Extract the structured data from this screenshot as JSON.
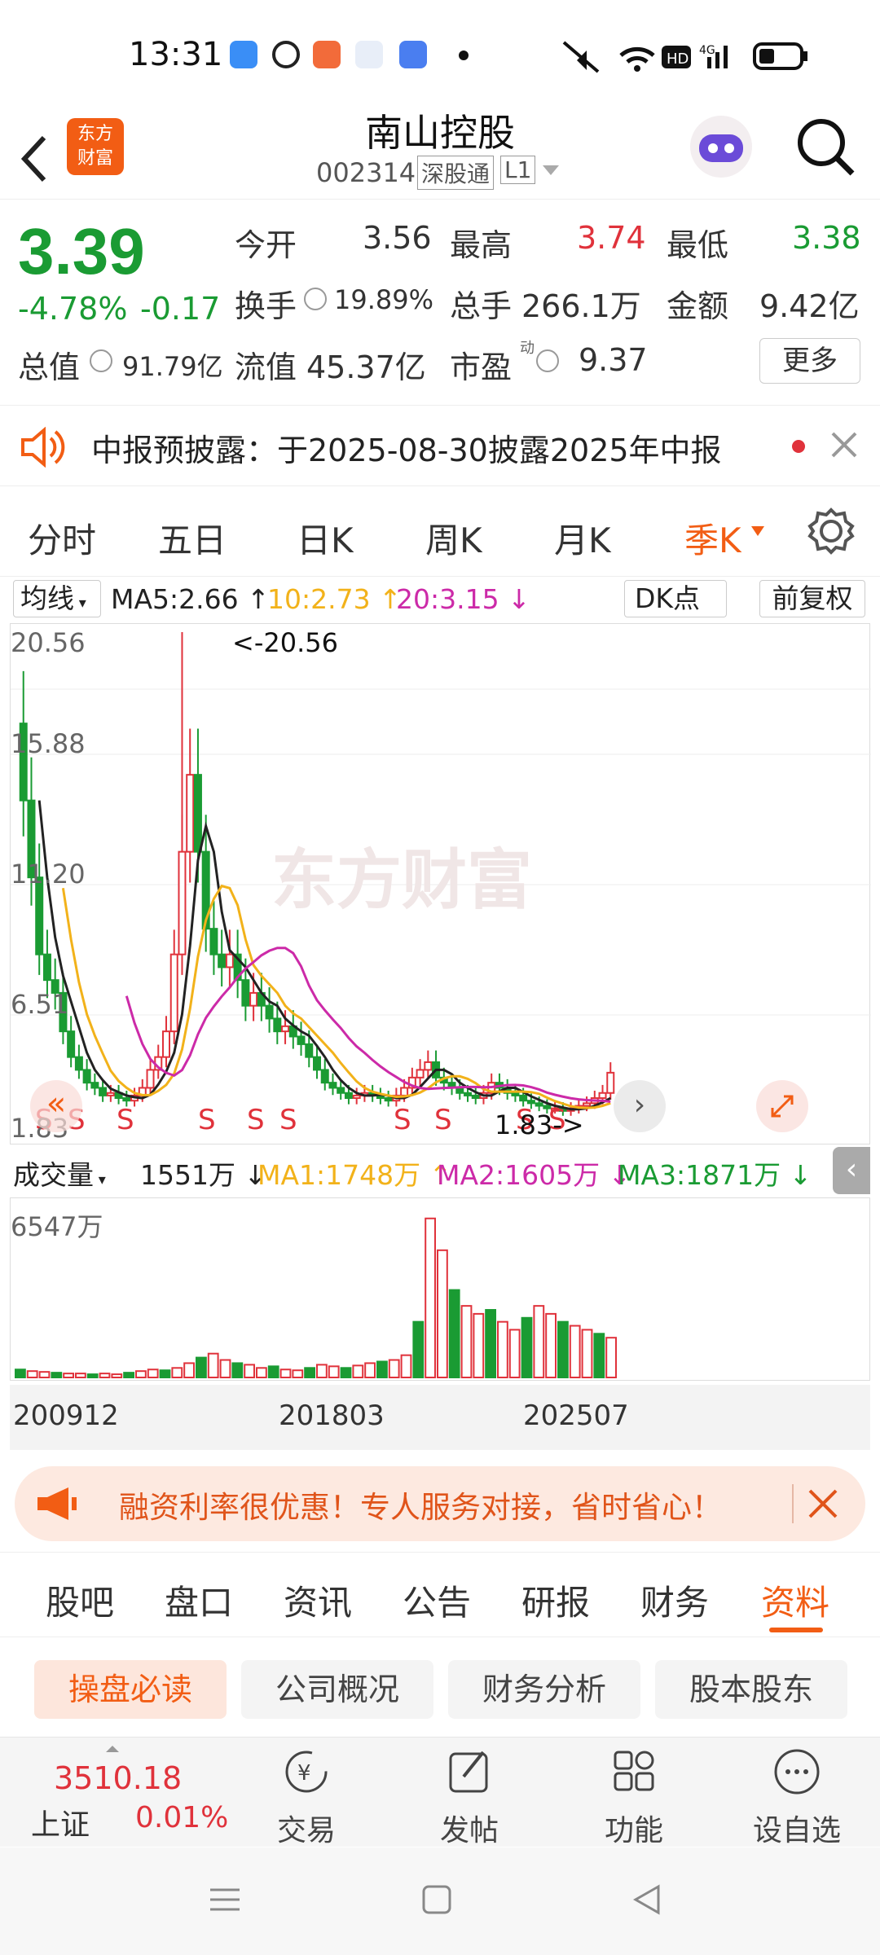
{
  "status": {
    "time": "13:31",
    "right_badge": "4G"
  },
  "header": {
    "title": "南山控股",
    "code": "002314",
    "tag1": "深股通",
    "tag2": "L1",
    "logo_top": "东方",
    "logo_bottom": "财富"
  },
  "quote": {
    "price": "3.39",
    "pct": "-4.78%",
    "chg": "-0.17",
    "open_label": "今开",
    "open": "3.56",
    "high_label": "最高",
    "high": "3.74",
    "low_label": "最低",
    "low": "3.38",
    "turnover_label": "换手",
    "turnover": "19.89%",
    "vol_label": "总手",
    "vol": "266.1万",
    "amount_label": "金额",
    "amount": "9.42亿",
    "mcap_label": "总值",
    "mcap": "91.79亿",
    "float_label": "流值",
    "float": "45.37亿",
    "pe_label": "市盈",
    "pe_sup": "动",
    "pe": "9.37",
    "more": "更多"
  },
  "notice": {
    "text": "中报预披露：于2025-08-30披露2025年中报"
  },
  "periods": [
    "分时",
    "五日",
    "日K",
    "周K",
    "月K"
  ],
  "period_active": "季K",
  "ma_legend": {
    "type": "均线",
    "ma5": "MA5:2.66",
    "ma10": "10:2.73",
    "ma20": "20:3.15",
    "dk": "DK点",
    "fq": "前复权"
  },
  "chart": {
    "y_labels": [
      "20.56",
      "15.88",
      "11.20",
      "6.51",
      "1.83"
    ],
    "max_label": "<-20.56",
    "min_label": "1.83->",
    "s_marker": "S",
    "watermark": "东方财富"
  },
  "vol_legend": {
    "label": "成交量",
    "cur": "1551万",
    "ma1": "MA1:1748万",
    "ma2": "MA2:1605万",
    "ma3": "MA3:1871万",
    "ymax": "6547万"
  },
  "dates": [
    "200912",
    "201803",
    "202507"
  ],
  "promo": {
    "text": "融资利率很优惠！专人服务对接，省时省心！"
  },
  "bottom_tabs": [
    "股吧",
    "盘口",
    "资讯",
    "公告",
    "研报",
    "财务",
    "资料"
  ],
  "sub_tabs": [
    "操盘必读",
    "公司概况",
    "财务分析",
    "股本股东"
  ],
  "index": {
    "value": "3510.18",
    "name": "上证",
    "pct": "0.01%"
  },
  "tools": [
    {
      "label": "交易",
      "icon": "trade-icon"
    },
    {
      "label": "发帖",
      "icon": "post-icon"
    },
    {
      "label": "功能",
      "icon": "apps-icon"
    },
    {
      "label": "设自选",
      "icon": "more-icon"
    }
  ],
  "colors": {
    "up": "#e0323b",
    "down": "#1a9b33",
    "accent": "#f25d14",
    "ma5": "#222222",
    "ma10": "#f2b21a",
    "ma20": "#cc2aa8"
  }
}
